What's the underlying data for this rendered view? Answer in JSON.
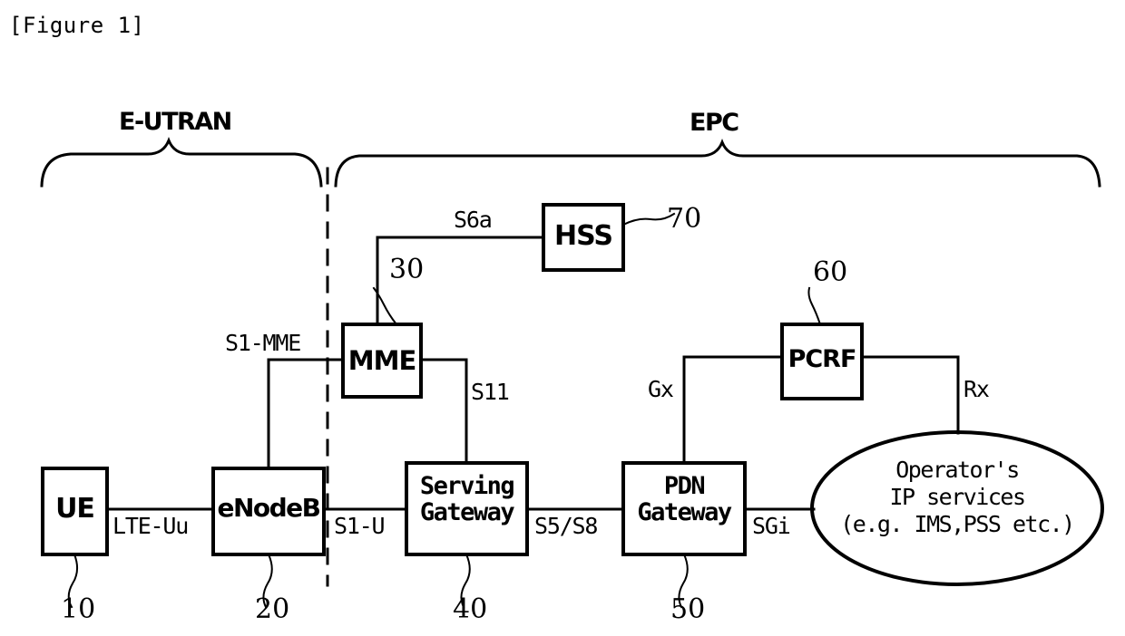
{
  "figure": {
    "caption": "[Figure 1]"
  },
  "domains": [
    {
      "id": "e-utran",
      "label": "E-UTRAN"
    },
    {
      "id": "epc",
      "label": "EPC"
    }
  ],
  "nodes": [
    {
      "id": "ue",
      "label": "UE",
      "ref": "10"
    },
    {
      "id": "enodeb",
      "label": "eNodeB",
      "ref": "20"
    },
    {
      "id": "mme",
      "label": "MME",
      "ref": "30"
    },
    {
      "id": "sgw",
      "label": "Serving\nGateway",
      "ref": "40"
    },
    {
      "id": "pgw",
      "label": "PDN\nGateway",
      "ref": "50"
    },
    {
      "id": "pcrf",
      "label": "PCRF",
      "ref": "60"
    },
    {
      "id": "hss",
      "label": "HSS",
      "ref": "70"
    }
  ],
  "cloud": {
    "id": "operator-ip-services",
    "line1": "Operator's",
    "line2": "IP services",
    "line3": "(e.g. IMS,PSS etc.)"
  },
  "interfaces": [
    {
      "id": "lte-uu",
      "label": "LTE-Uu"
    },
    {
      "id": "s1-u",
      "label": "S1-U"
    },
    {
      "id": "s1-mme",
      "label": "S1-MME"
    },
    {
      "id": "s11",
      "label": "S11"
    },
    {
      "id": "s6a",
      "label": "S6a"
    },
    {
      "id": "s5-s8",
      "label": "S5/S8"
    },
    {
      "id": "sgi",
      "label": "SGi"
    },
    {
      "id": "gx",
      "label": "Gx"
    },
    {
      "id": "rx",
      "label": "Rx"
    }
  ],
  "colors": {
    "line": "#000000",
    "background": "#ffffff"
  }
}
